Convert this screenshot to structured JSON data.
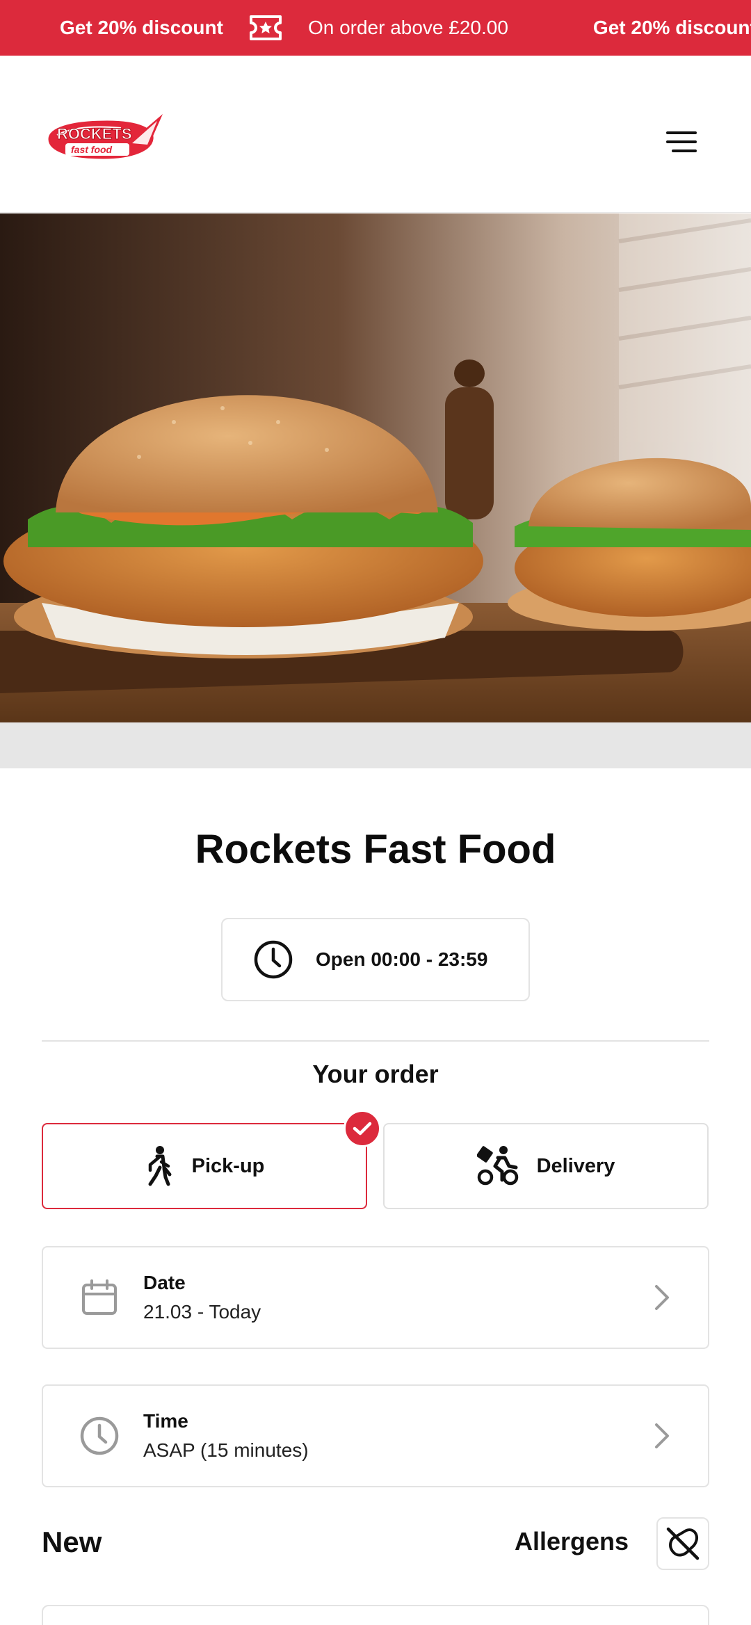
{
  "promo": {
    "discount_text": "Get 20% discount",
    "condition_text": "On order above £20.00",
    "discount_text_repeat": "Get 20% discount"
  },
  "header": {
    "logo_word": "ROCKETS",
    "logo_tagline": "fast food"
  },
  "restaurant": {
    "name": "Rockets Fast Food",
    "hours": "Open 00:00 - 23:59"
  },
  "order": {
    "title": "Your order",
    "pickup_label": "Pick-up",
    "delivery_label": "Delivery",
    "selected": "Pick-up",
    "date_label": "Date",
    "date_value": "21.03 - Today",
    "time_label": "Time",
    "time_value": "ASAP (15 minutes)"
  },
  "menu_section": {
    "title": "New",
    "allergens_label": "Allergens"
  },
  "colors": {
    "brand_red": "#dc2a3c",
    "border_gray": "#e3e3e3"
  }
}
